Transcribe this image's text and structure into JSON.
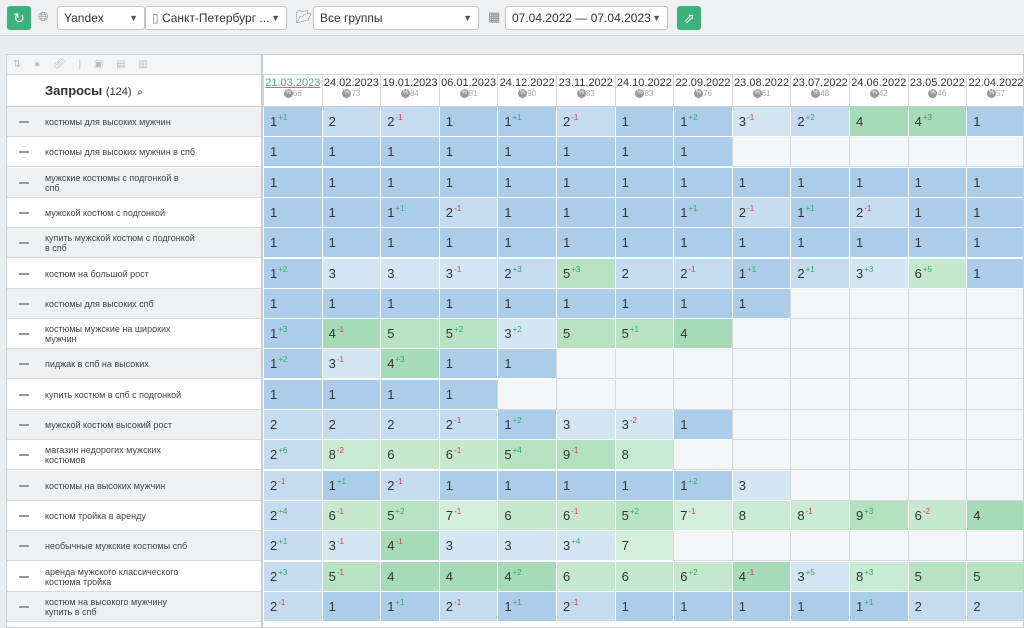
{
  "toolbar": {
    "search_engine": "Yandex",
    "region": "Санкт-Петербург ...",
    "group": "Все группы",
    "date_range": "07.04.2022 — 07.04.2023"
  },
  "queries_header": {
    "title": "Запросы",
    "count": "(124)"
  },
  "dates": [
    {
      "d": "21.03.2023",
      "v": "66"
    },
    {
      "d": "24.02.2023",
      "v": "73"
    },
    {
      "d": "19.01.2023",
      "v": "84"
    },
    {
      "d": "06.01.2023",
      "v": "81"
    },
    {
      "d": "24.12.2022",
      "v": "90"
    },
    {
      "d": "23.11.2022",
      "v": "83"
    },
    {
      "d": "24.10.2022",
      "v": "83"
    },
    {
      "d": "22.09.2022",
      "v": "76"
    },
    {
      "d": "23.08.2022",
      "v": "61"
    },
    {
      "d": "23.07.2022",
      "v": "48"
    },
    {
      "d": "24.06.2022",
      "v": "42"
    },
    {
      "d": "23.05.2022",
      "v": "46"
    },
    {
      "d": "22.04.2022",
      "v": "57"
    }
  ],
  "rows": [
    {
      "q": "костюмы для высоких мужчин",
      "cells": [
        [
          "1",
          "+1"
        ],
        [
          "2",
          ""
        ],
        [
          "2",
          "-1"
        ],
        [
          "1",
          ""
        ],
        [
          "1",
          "+1"
        ],
        [
          "2",
          "-1"
        ],
        [
          "1",
          ""
        ],
        [
          "1",
          "+2"
        ],
        [
          "3",
          "-1"
        ],
        [
          "2",
          "+2"
        ],
        [
          "4",
          ""
        ],
        [
          "4",
          "+3"
        ],
        [
          "1",
          ""
        ]
      ]
    },
    {
      "q": "костюмы для высоких мужчин в спб",
      "cells": [
        [
          "1",
          ""
        ],
        [
          "1",
          ""
        ],
        [
          "1",
          ""
        ],
        [
          "1",
          ""
        ],
        [
          "1",
          ""
        ],
        [
          "1",
          ""
        ],
        [
          "1",
          ""
        ],
        [
          "1",
          ""
        ],
        null,
        null,
        null,
        null,
        null
      ]
    },
    {
      "q": "мужские костюмы с подгонкой в спб",
      "cells": [
        [
          "1",
          ""
        ],
        [
          "1",
          ""
        ],
        [
          "1",
          ""
        ],
        [
          "1",
          ""
        ],
        [
          "1",
          ""
        ],
        [
          "1",
          ""
        ],
        [
          "1",
          ""
        ],
        [
          "1",
          ""
        ],
        [
          "1",
          ""
        ],
        [
          "1",
          ""
        ],
        [
          "1",
          ""
        ],
        [
          "1",
          ""
        ],
        [
          "1",
          ""
        ]
      ]
    },
    {
      "q": "мужской костюм с подгонкой",
      "cells": [
        [
          "1",
          ""
        ],
        [
          "1",
          ""
        ],
        [
          "1",
          "+1"
        ],
        [
          "2",
          "-1"
        ],
        [
          "1",
          ""
        ],
        [
          "1",
          ""
        ],
        [
          "1",
          ""
        ],
        [
          "1",
          "+1"
        ],
        [
          "2",
          "-1"
        ],
        [
          "1",
          "+1"
        ],
        [
          "2",
          "-1"
        ],
        [
          "1",
          ""
        ],
        [
          "1",
          ""
        ]
      ]
    },
    {
      "q": "купить мужской костюм с подгонкой в спб",
      "cells": [
        [
          "1",
          ""
        ],
        [
          "1",
          ""
        ],
        [
          "1",
          ""
        ],
        [
          "1",
          ""
        ],
        [
          "1",
          ""
        ],
        [
          "1",
          ""
        ],
        [
          "1",
          ""
        ],
        [
          "1",
          ""
        ],
        [
          "1",
          ""
        ],
        [
          "1",
          ""
        ],
        [
          "1",
          ""
        ],
        [
          "1",
          ""
        ],
        [
          "1",
          ""
        ]
      ]
    },
    {
      "q": "костюм на большой рост",
      "cells": [
        [
          "1",
          "+2"
        ],
        [
          "3",
          ""
        ],
        [
          "3",
          ""
        ],
        [
          "3",
          "-1"
        ],
        [
          "2",
          "+3"
        ],
        [
          "5",
          "+3"
        ],
        [
          "2",
          ""
        ],
        [
          "2",
          "-1"
        ],
        [
          "1",
          "+1"
        ],
        [
          "2",
          "+1"
        ],
        [
          "3",
          "+3"
        ],
        [
          "6",
          "+5"
        ],
        [
          "1",
          ""
        ]
      ]
    },
    {
      "q": "костюмы для высоких спб",
      "cells": [
        [
          "1",
          ""
        ],
        [
          "1",
          ""
        ],
        [
          "1",
          ""
        ],
        [
          "1",
          ""
        ],
        [
          "1",
          ""
        ],
        [
          "1",
          ""
        ],
        [
          "1",
          ""
        ],
        [
          "1",
          ""
        ],
        [
          "1",
          ""
        ],
        null,
        null,
        null,
        null
      ]
    },
    {
      "q": "костюмы мужские на широких мужчин",
      "cells": [
        [
          "1",
          "+3"
        ],
        [
          "4",
          "-1"
        ],
        [
          "5",
          ""
        ],
        [
          "5",
          "+2"
        ],
        [
          "3",
          "+2"
        ],
        [
          "5",
          ""
        ],
        [
          "5",
          "+1"
        ],
        [
          "4",
          ""
        ],
        null,
        null,
        null,
        null,
        null
      ]
    },
    {
      "q": "пиджак в спб на высоких",
      "cells": [
        [
          "1",
          "+2"
        ],
        [
          "3",
          "-1"
        ],
        [
          "4",
          "+3"
        ],
        [
          "1",
          ""
        ],
        [
          "1",
          ""
        ],
        null,
        null,
        null,
        null,
        null,
        null,
        null,
        null
      ]
    },
    {
      "q": "купить костюм в спб с подгонкой",
      "cells": [
        [
          "1",
          ""
        ],
        [
          "1",
          ""
        ],
        [
          "1",
          ""
        ],
        [
          "1",
          ""
        ],
        null,
        null,
        null,
        null,
        null,
        null,
        null,
        null,
        null
      ]
    },
    {
      "q": "мужской костюм высокий рост",
      "cells": [
        [
          "2",
          ""
        ],
        [
          "2",
          ""
        ],
        [
          "2",
          ""
        ],
        [
          "2",
          "-1"
        ],
        [
          "1",
          "+2"
        ],
        [
          "3",
          ""
        ],
        [
          "3",
          "-2"
        ],
        [
          "1",
          ""
        ],
        null,
        null,
        null,
        null,
        null
      ]
    },
    {
      "q": "магазин недорогих мужских костюмов",
      "cells": [
        [
          "2",
          "+6"
        ],
        [
          "8",
          "-2"
        ],
        [
          "6",
          ""
        ],
        [
          "6",
          "-1"
        ],
        [
          "5",
          "+4"
        ],
        [
          "9",
          "-1"
        ],
        [
          "8",
          ""
        ],
        null,
        null,
        null,
        null,
        null,
        null
      ]
    },
    {
      "q": "костюмы на высоких мужчин",
      "cells": [
        [
          "2",
          "-1"
        ],
        [
          "1",
          "+1"
        ],
        [
          "2",
          "-1"
        ],
        [
          "1",
          ""
        ],
        [
          "1",
          ""
        ],
        [
          "1",
          ""
        ],
        [
          "1",
          ""
        ],
        [
          "1",
          "+2"
        ],
        [
          "3",
          ""
        ],
        null,
        null,
        null,
        null
      ]
    },
    {
      "q": "костюм тройка в аренду",
      "cells": [
        [
          "2",
          "+4"
        ],
        [
          "6",
          "-1"
        ],
        [
          "5",
          "+2"
        ],
        [
          "7",
          "-1"
        ],
        [
          "6",
          ""
        ],
        [
          "6",
          "-1"
        ],
        [
          "5",
          "+2"
        ],
        [
          "7",
          "-1"
        ],
        [
          "8",
          ""
        ],
        [
          "8",
          "-1"
        ],
        [
          "9",
          "+3"
        ],
        [
          "6",
          "-2"
        ],
        [
          "4",
          ""
        ]
      ]
    },
    {
      "q": "необычные мужские костюмы спб",
      "cells": [
        [
          "2",
          "+1"
        ],
        [
          "3",
          "-1"
        ],
        [
          "4",
          "-1"
        ],
        [
          "3",
          ""
        ],
        [
          "3",
          ""
        ],
        [
          "3",
          "+4"
        ],
        [
          "7",
          ""
        ],
        null,
        null,
        null,
        null,
        null,
        null
      ]
    },
    {
      "q": "аренда мужского классического костюма тройка",
      "cells": [
        [
          "2",
          "+3"
        ],
        [
          "5",
          "-1"
        ],
        [
          "4",
          ""
        ],
        [
          "4",
          ""
        ],
        [
          "4",
          "+2"
        ],
        [
          "6",
          ""
        ],
        [
          "6",
          ""
        ],
        [
          "6",
          "+2"
        ],
        [
          "4",
          "-1"
        ],
        [
          "3",
          "+5"
        ],
        [
          "8",
          "+3"
        ],
        [
          "5",
          ""
        ],
        [
          "5",
          ""
        ]
      ]
    },
    {
      "q": "костюм на высокого мужчину купить в спб",
      "cells": [
        [
          "2",
          "-1"
        ],
        [
          "1",
          ""
        ],
        [
          "1",
          "+1"
        ],
        [
          "2",
          "-1"
        ],
        [
          "1",
          "+1"
        ],
        [
          "2",
          "-1"
        ],
        [
          "1",
          ""
        ],
        [
          "1",
          ""
        ],
        [
          "1",
          ""
        ],
        [
          "1",
          ""
        ],
        [
          "1",
          "+1"
        ],
        [
          "2",
          ""
        ],
        [
          "2",
          ""
        ]
      ]
    }
  ]
}
